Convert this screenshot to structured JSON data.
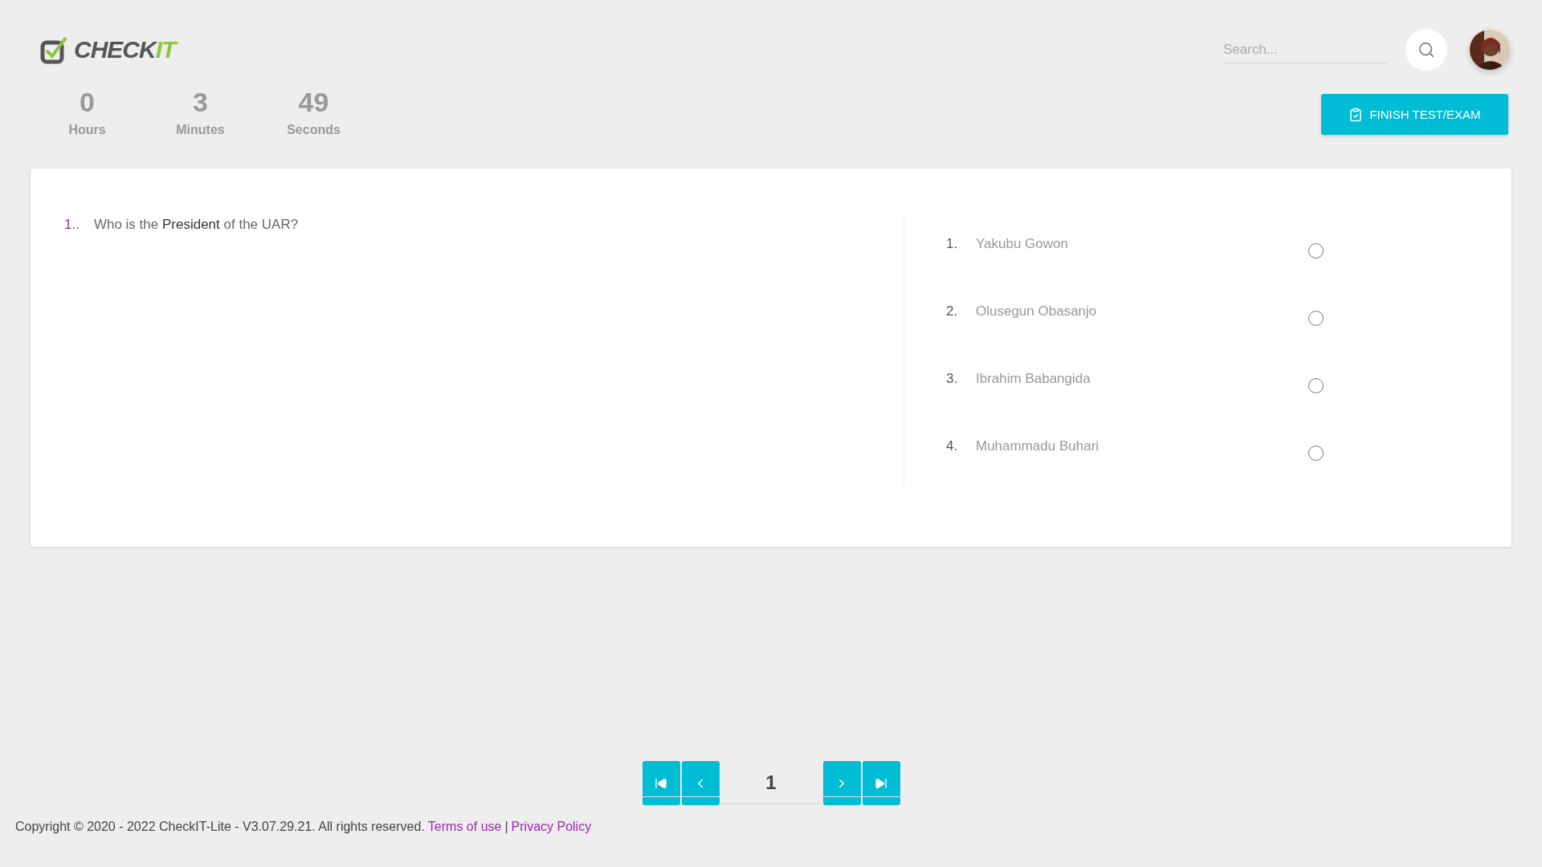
{
  "logo": {
    "dark": "CHECK",
    "accent": "IT"
  },
  "search": {
    "placeholder": "Search..."
  },
  "timer": [
    {
      "value": "0",
      "unit": "Hours"
    },
    {
      "value": "3",
      "unit": "Minutes"
    },
    {
      "value": "49",
      "unit": "Seconds"
    }
  ],
  "finish_button": {
    "label": "FINISH TEST/EXAM"
  },
  "question": {
    "number": "1..",
    "text": "Who is the **President** of the UAR?"
  },
  "options": [
    {
      "number": "1.",
      "text": "Yakubu Gowon",
      "selected": false
    },
    {
      "number": "2.",
      "text": "Olusegun Obasanjo",
      "selected": false
    },
    {
      "number": "3.",
      "text": "Ibrahim Babangida",
      "selected": false
    },
    {
      "number": "4.",
      "text": "Muhammadu Buhari",
      "selected": false
    }
  ],
  "pagination": {
    "page": "1"
  },
  "footer": {
    "copyright": "Copyright © 2020 - 2022 CheckIT-Lite - V3.07.29.21. All rights reserved.",
    "links": [
      "Terms of use",
      "Privacy Policy"
    ],
    "separator": "|"
  }
}
